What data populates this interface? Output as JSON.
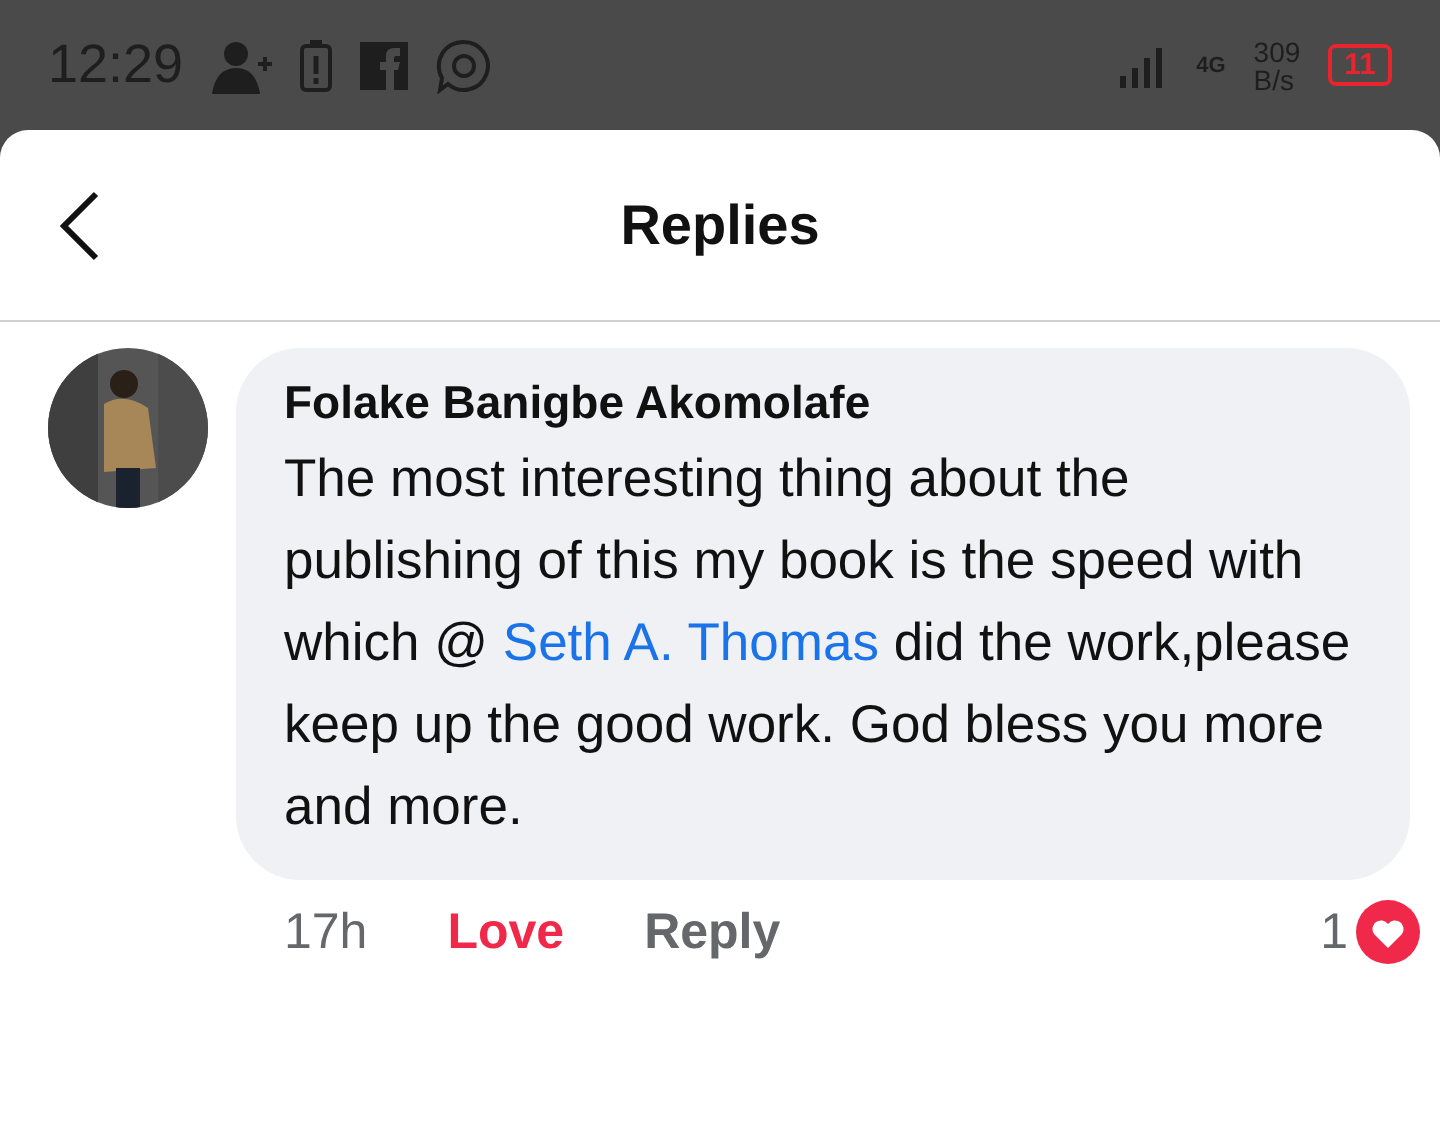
{
  "status_bar": {
    "time": "12:29",
    "network": "4G",
    "speed": "309",
    "speed_unit": "B/s",
    "battery": "11"
  },
  "header": {
    "title": "Replies"
  },
  "comment": {
    "author": "Folake Banigbe Akomolafe",
    "text_before": "The most interesting thing about the publishing of this my book is the speed with which @ ",
    "mention": "Seth A. Thomas",
    "text_after": " did the work,please keep up the good work.  God bless you more and more.",
    "time": "17h",
    "love_label": "Love",
    "loved": true,
    "reply_label": "Reply",
    "reaction_count": "1"
  }
}
